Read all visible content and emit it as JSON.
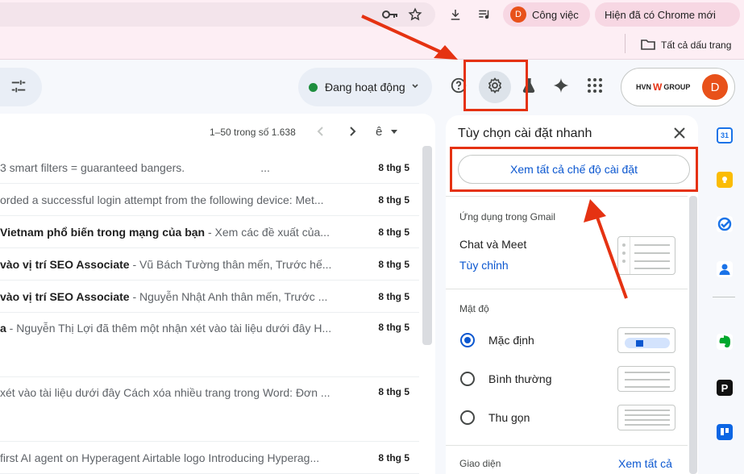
{
  "browser": {
    "profile_initial": "D",
    "profile_label": "Công việc",
    "update_label": "Hiện đã có Chrome mới",
    "bookmarks_folder": "Tất cả dấu trang"
  },
  "header": {
    "status_label": "Đang hoạt động",
    "org_logo_text_left": "HVN",
    "org_logo_text_right": "GROUP",
    "avatar_initial": "D"
  },
  "list": {
    "pagination": "1–50 trong số 1.638",
    "rows": [
      {
        "bold": "",
        "snippet": "3 smart filters = guaranteed bangers.",
        "date": "8 thg 5"
      },
      {
        "bold": "",
        "snippet": "orded a successful login attempt from the following device: Met...",
        "date": "8 thg 5"
      },
      {
        "bold": "Vietnam phổ biến trong mạng của bạn",
        "snippet": " - Xem các đề xuất của...",
        "date": "8 thg 5"
      },
      {
        "bold": "vào vị trí SEO Associate",
        "snippet": " - Vũ Bách Tường thân mến, Trước hế...",
        "date": "8 thg 5"
      },
      {
        "bold": "vào vị trí SEO Associate",
        "snippet": " - Nguyễn Nhật Anh thân mến, Trước ...",
        "date": "8 thg 5"
      },
      {
        "bold": "a",
        "snippet": " - Nguyễn Thị Lợi đã thêm một nhận xét vào tài liệu dưới đây H...",
        "date": "8 thg 5"
      },
      {
        "bold": "",
        "snippet": "xét vào tài liệu dưới đây Cách xóa nhiều trang trong Word: Đơn ...",
        "date": "8 thg 5"
      },
      {
        "bold": "",
        "snippet": "first AI agent on Hyperagent Airtable logo Introducing Hyperag...",
        "date": "8 thg 5"
      }
    ]
  },
  "quick_settings": {
    "title": "Tùy chọn cài đặt nhanh",
    "see_all_button": "Xem tất cả chế độ cài đặt",
    "apps_label": "Ứng dụng trong Gmail",
    "chat_meet": "Chat và Meet",
    "customize": "Tùy chỉnh",
    "density_label": "Mật độ",
    "density_options": [
      "Mặc định",
      "Bình thường",
      "Thu gọn"
    ],
    "selected_density": "Mặc định",
    "theme_label": "Giao diện",
    "theme_see_all": "Xem tất cả"
  },
  "colors": {
    "annotation_red": "#e53212",
    "accent_blue": "#0b57d0",
    "status_green": "#1e8e3e",
    "avatar_orange": "#e8511a"
  }
}
